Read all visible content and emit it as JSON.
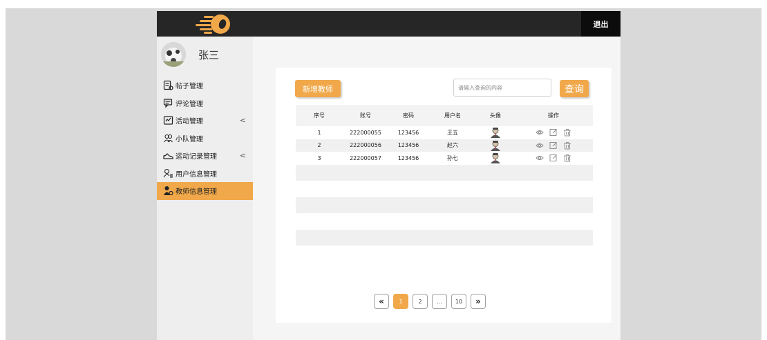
{
  "topbar": {
    "logout_label": "退出"
  },
  "user": {
    "name": "张三"
  },
  "sidebar": {
    "items": [
      {
        "label": "帖子管理",
        "icon": "post-icon",
        "has_arrow": false
      },
      {
        "label": "评论管理",
        "icon": "comment-icon",
        "has_arrow": false
      },
      {
        "label": "活动管理",
        "icon": "activity-icon",
        "has_arrow": true
      },
      {
        "label": "小队管理",
        "icon": "team-icon",
        "has_arrow": false
      },
      {
        "label": "运动记录管理",
        "icon": "shoe-icon",
        "has_arrow": true
      },
      {
        "label": "用户信息管理",
        "icon": "user-list-icon",
        "has_arrow": false
      },
      {
        "label": "教师信息管理",
        "icon": "teacher-icon",
        "has_arrow": false,
        "active": true
      }
    ],
    "arrow_glyph": "<"
  },
  "toolbar": {
    "add_label": "新增教师",
    "search_placeholder": "请输入查询的内容",
    "query_label": "查询"
  },
  "table": {
    "headers": [
      "序号",
      "账号",
      "密码",
      "用户名",
      "头像",
      "操作"
    ],
    "rows": [
      {
        "index": "1",
        "account": "222000055",
        "password": "123456",
        "username": "王五"
      },
      {
        "index": "2",
        "account": "222000056",
        "password": "123456",
        "username": "赵六"
      },
      {
        "index": "3",
        "account": "222000057",
        "password": "123456",
        "username": "孙七"
      }
    ]
  },
  "pagination": {
    "prev": "«",
    "pages": [
      "1",
      "2",
      "...",
      "10"
    ],
    "current": "1",
    "next": "»"
  },
  "colors": {
    "accent": "#f0a84a",
    "topbar": "#262626"
  }
}
